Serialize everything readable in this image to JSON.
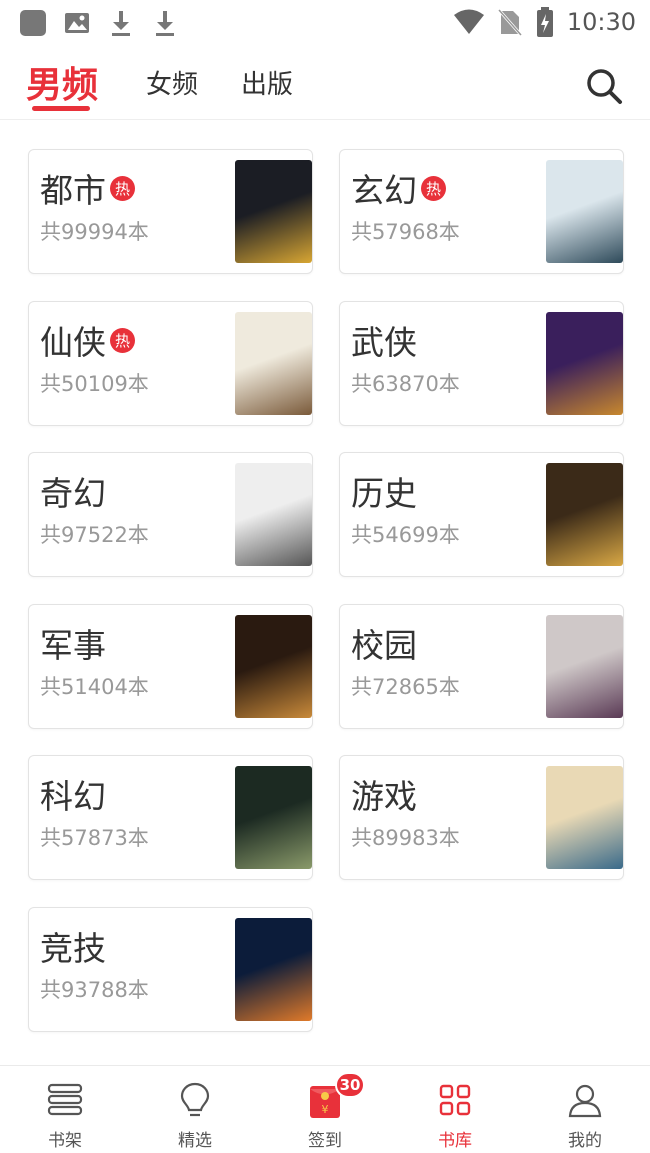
{
  "status_bar": {
    "time": "10:30",
    "left_icons": [
      "app-icon",
      "image-icon",
      "download-icon",
      "download-icon"
    ],
    "right_icons": [
      "wifi-icon",
      "no-sim-icon",
      "battery-charging-icon"
    ]
  },
  "top_nav": {
    "tabs": [
      {
        "label": "男频",
        "active": true
      },
      {
        "label": "女频",
        "active": false
      },
      {
        "label": "出版",
        "active": false
      }
    ],
    "search_icon": "search-icon",
    "accent_color": "#e8313a"
  },
  "categories": [
    {
      "name": "都市",
      "hot": true,
      "hot_label": "热",
      "count": "共99994本",
      "cover_colors": [
        "#1b1d24",
        "#d8a633"
      ]
    },
    {
      "name": "玄幻",
      "hot": true,
      "hot_label": "热",
      "count": "共57968本",
      "cover_colors": [
        "#dbe6ec",
        "#2e4a5a"
      ]
    },
    {
      "name": "仙侠",
      "hot": true,
      "hot_label": "热",
      "count": "共50109本",
      "cover_colors": [
        "#efeadd",
        "#7a5a3a"
      ]
    },
    {
      "name": "武侠",
      "hot": false,
      "hot_label": "",
      "count": "共63870本",
      "cover_colors": [
        "#3a1f5c",
        "#c8882e"
      ]
    },
    {
      "name": "奇幻",
      "hot": false,
      "hot_label": "",
      "count": "共97522本",
      "cover_colors": [
        "#eeeeee",
        "#555555"
      ]
    },
    {
      "name": "历史",
      "hot": false,
      "hot_label": "",
      "count": "共54699本",
      "cover_colors": [
        "#3b2a18",
        "#d9a845"
      ]
    },
    {
      "name": "军事",
      "hot": false,
      "hot_label": "",
      "count": "共51404本",
      "cover_colors": [
        "#2a1a10",
        "#c98a3a"
      ]
    },
    {
      "name": "校园",
      "hot": false,
      "hot_label": "",
      "count": "共72865本",
      "cover_colors": [
        "#cfc8c8",
        "#5a3a55"
      ]
    },
    {
      "name": "科幻",
      "hot": false,
      "hot_label": "",
      "count": "共57873本",
      "cover_colors": [
        "#1c2a22",
        "#8a9a6a"
      ]
    },
    {
      "name": "游戏",
      "hot": false,
      "hot_label": "",
      "count": "共89983本",
      "cover_colors": [
        "#e9d9b5",
        "#3a6a8a"
      ]
    },
    {
      "name": "竞技",
      "hot": false,
      "hot_label": "",
      "count": "共93788本",
      "cover_colors": [
        "#0c1c3a",
        "#e07a2a"
      ]
    }
  ],
  "bottom_nav": {
    "items": [
      {
        "label": "书架",
        "icon": "bookshelf-icon",
        "active": false
      },
      {
        "label": "精选",
        "icon": "lightbulb-icon",
        "active": false
      },
      {
        "label": "签到",
        "icon": "red-envelope-icon",
        "active": false,
        "badge": "30"
      },
      {
        "label": "书库",
        "icon": "grid-icon",
        "active": true
      },
      {
        "label": "我的",
        "icon": "person-icon",
        "active": false
      }
    ]
  }
}
